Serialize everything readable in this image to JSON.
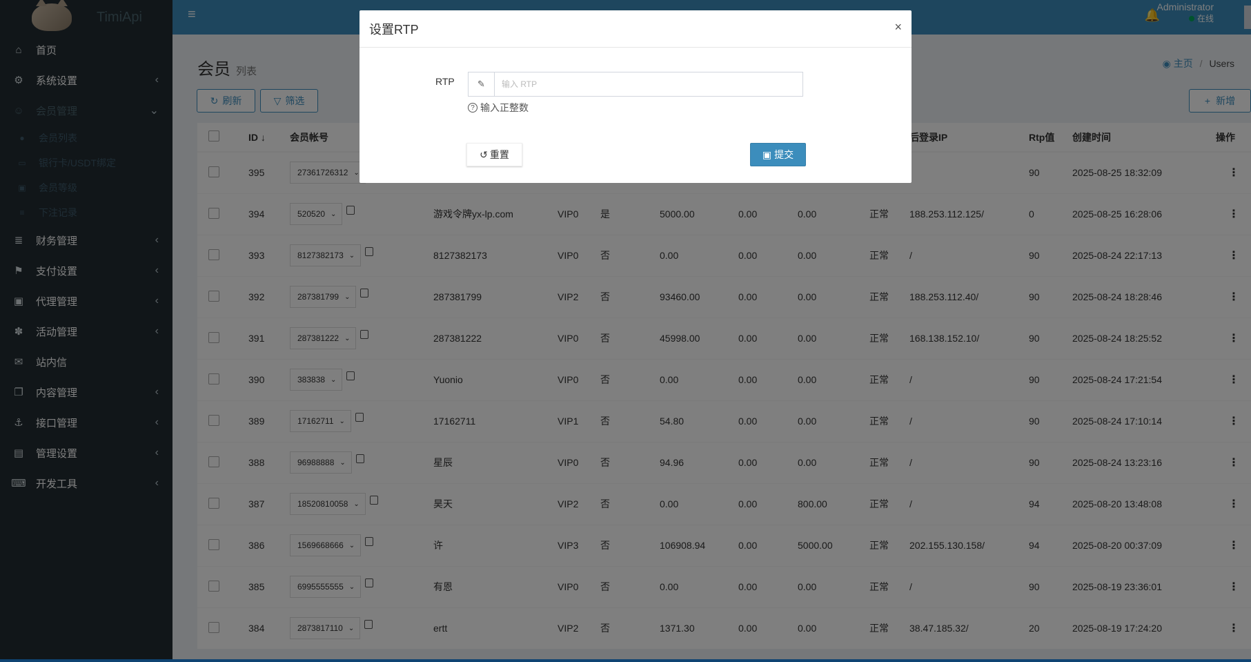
{
  "app": {
    "brand": "TimiApi"
  },
  "header": {
    "user_name": "Administrator",
    "status": "在线"
  },
  "sidebar": {
    "items": [
      {
        "label": "首页",
        "icon": "home-icon",
        "glyph": "⌂",
        "chev": ""
      },
      {
        "label": "系统设置",
        "icon": "gears-icon",
        "glyph": "⚙",
        "chev": "‹"
      },
      {
        "label": "会员管理",
        "icon": "user-icon",
        "glyph": "☺",
        "chev": "⌄",
        "active": true
      },
      {
        "label": "财务管理",
        "icon": "database-icon",
        "glyph": "≣",
        "chev": "‹"
      },
      {
        "label": "支付设置",
        "icon": "bookmark-icon",
        "glyph": "⚑",
        "chev": "‹"
      },
      {
        "label": "代理管理",
        "icon": "contact-book-icon",
        "glyph": "▣",
        "chev": "‹"
      },
      {
        "label": "活动管理",
        "icon": "pinwheel-icon",
        "glyph": "✽",
        "chev": "‹"
      },
      {
        "label": "站内信",
        "icon": "envelope-icon",
        "glyph": "✉",
        "chev": ""
      },
      {
        "label": "内容管理",
        "icon": "copy-icon",
        "glyph": "❐",
        "chev": "‹"
      },
      {
        "label": "接口管理",
        "icon": "anchor-icon",
        "glyph": "⚓",
        "chev": "‹"
      },
      {
        "label": "管理设置",
        "icon": "id-card-icon",
        "glyph": "▤",
        "chev": "‹"
      },
      {
        "label": "开发工具",
        "icon": "keyboard-icon",
        "glyph": "⌨",
        "chev": "‹"
      }
    ],
    "subitems": [
      {
        "label": "会员列表",
        "icon": "user-small-icon",
        "glyph": "●"
      },
      {
        "label": "银行卡/USDT绑定",
        "icon": "credit-card-icon",
        "glyph": "▭"
      },
      {
        "label": "会员等级",
        "icon": "badge-icon",
        "glyph": "▣"
      },
      {
        "label": "下注记录",
        "icon": "list-icon",
        "glyph": "≡"
      }
    ]
  },
  "page": {
    "title": "会员",
    "subtitle": "列表",
    "breadcrumb_home": "主页",
    "breadcrumb_sep": "/",
    "breadcrumb_current": "Users",
    "refresh_label": "刷新",
    "filter_label": "筛选",
    "new_label": "新增"
  },
  "table": {
    "headers": [
      "ID ↓",
      "会员帐号",
      "",
      "",
      "",
      "",
      "",
      "",
      "",
      "后登录IP",
      "Rtp值",
      "创建时间",
      "操作"
    ],
    "rows": [
      [
        "395",
        "27361726312",
        "",
        "",
        "",
        "",
        "",
        "",
        "",
        "",
        "90",
        "2025-08-25 18:32:09"
      ],
      [
        "394",
        "520520",
        "游戏令牌yx-lp.com",
        "VIP0",
        "是",
        "5000.00",
        "0.00",
        "0.00",
        "正常",
        "188.253.112.125/",
        "0",
        "2025-08-25 16:28:06"
      ],
      [
        "393",
        "8127382173",
        "8127382173",
        "VIP0",
        "否",
        "0.00",
        "0.00",
        "0.00",
        "正常",
        "/",
        "90",
        "2025-08-24 22:17:13"
      ],
      [
        "392",
        "287381799",
        "287381799",
        "VIP2",
        "否",
        "93460.00",
        "0.00",
        "0.00",
        "正常",
        "188.253.112.40/",
        "90",
        "2025-08-24 18:28:46"
      ],
      [
        "391",
        "287381222",
        "287381222",
        "VIP0",
        "否",
        "45998.00",
        "0.00",
        "0.00",
        "正常",
        "168.138.152.10/",
        "90",
        "2025-08-24 18:25:52"
      ],
      [
        "390",
        "383838",
        "Yuonio",
        "VIP0",
        "否",
        "0.00",
        "0.00",
        "0.00",
        "正常",
        "/",
        "90",
        "2025-08-24 17:21:54"
      ],
      [
        "389",
        "17162711",
        "17162711",
        "VIP1",
        "否",
        "54.80",
        "0.00",
        "0.00",
        "正常",
        "/",
        "90",
        "2025-08-24 17:10:14"
      ],
      [
        "388",
        "96988888",
        "星辰",
        "VIP0",
        "否",
        "94.96",
        "0.00",
        "0.00",
        "正常",
        "/",
        "90",
        "2025-08-24 13:23:16"
      ],
      [
        "387",
        "18520810058",
        "昊天",
        "VIP2",
        "否",
        "0.00",
        "0.00",
        "800.00",
        "正常",
        "/",
        "94",
        "2025-08-20 13:48:08"
      ],
      [
        "386",
        "1569668666",
        "许",
        "VIP3",
        "否",
        "106908.94",
        "0.00",
        "5000.00",
        "正常",
        "202.155.130.158/",
        "94",
        "2025-08-20 00:37:09"
      ],
      [
        "385",
        "6995555555",
        "有恩",
        "VIP0",
        "否",
        "0.00",
        "0.00",
        "0.00",
        "正常",
        "/",
        "90",
        "2025-08-19 23:36:01"
      ],
      [
        "384",
        "2873817110",
        "ertt",
        "VIP2",
        "否",
        "1371.30",
        "0.00",
        "0.00",
        "正常",
        "38.47.185.32/",
        "20",
        "2025-08-19 17:24:20"
      ]
    ]
  },
  "modal": {
    "title": "设置RTP",
    "close": "×",
    "field_label": "RTP",
    "placeholder": "输入 RTP",
    "help": "输入正整数",
    "reset_label": "重置",
    "submit_label": "提交"
  }
}
